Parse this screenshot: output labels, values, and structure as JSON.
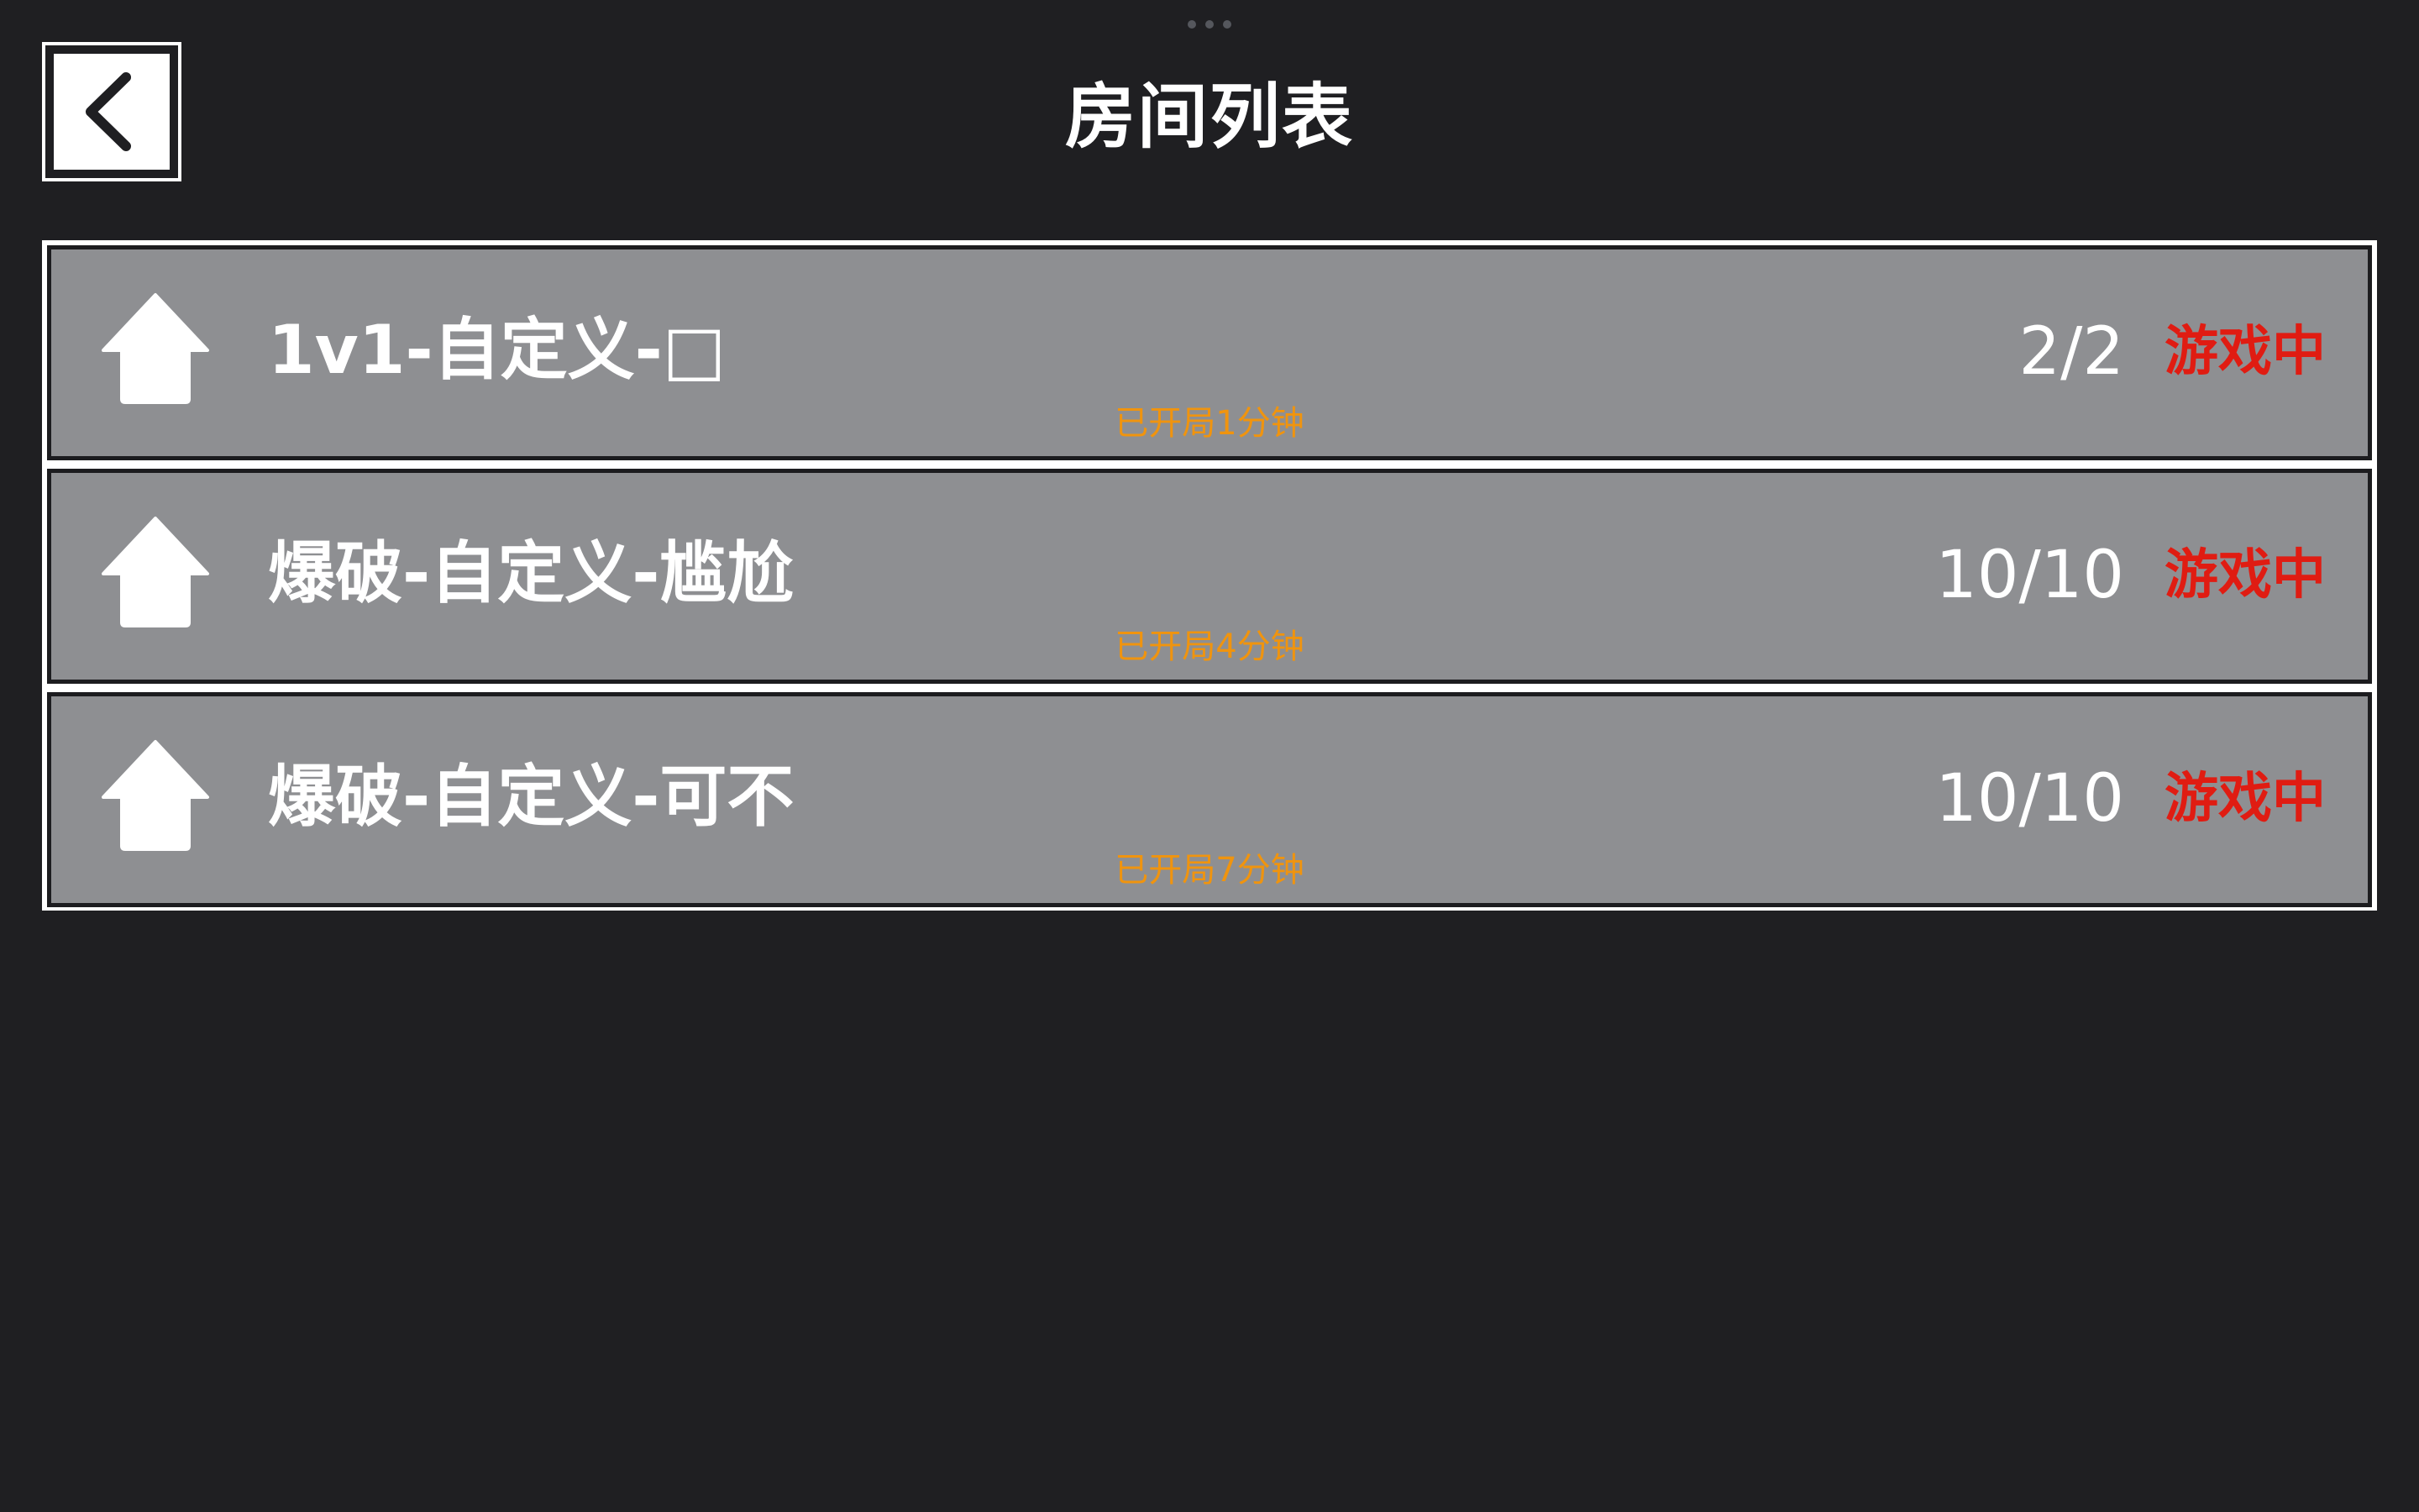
{
  "header": {
    "title": "房间列表",
    "back_icon": "chevron-left-icon"
  },
  "rooms": [
    {
      "name": "1v1-自定义-□",
      "count": "2/2",
      "status": "游戏中",
      "elapsed": "已开局1分钟",
      "icon": "house-icon"
    },
    {
      "name": "爆破-自定义-尴尬",
      "count": "10/10",
      "status": "游戏中",
      "elapsed": "已开局4分钟",
      "icon": "house-icon"
    },
    {
      "name": "爆破-自定义-可不",
      "count": "10/10",
      "status": "游戏中",
      "elapsed": "已开局7分钟",
      "icon": "house-icon"
    }
  ],
  "colors": {
    "background": "#1f1f22",
    "row_background": "#8e8f92",
    "status_red": "#e01c12",
    "elapsed_orange": "#f0940e",
    "text_white": "#ffffff"
  }
}
